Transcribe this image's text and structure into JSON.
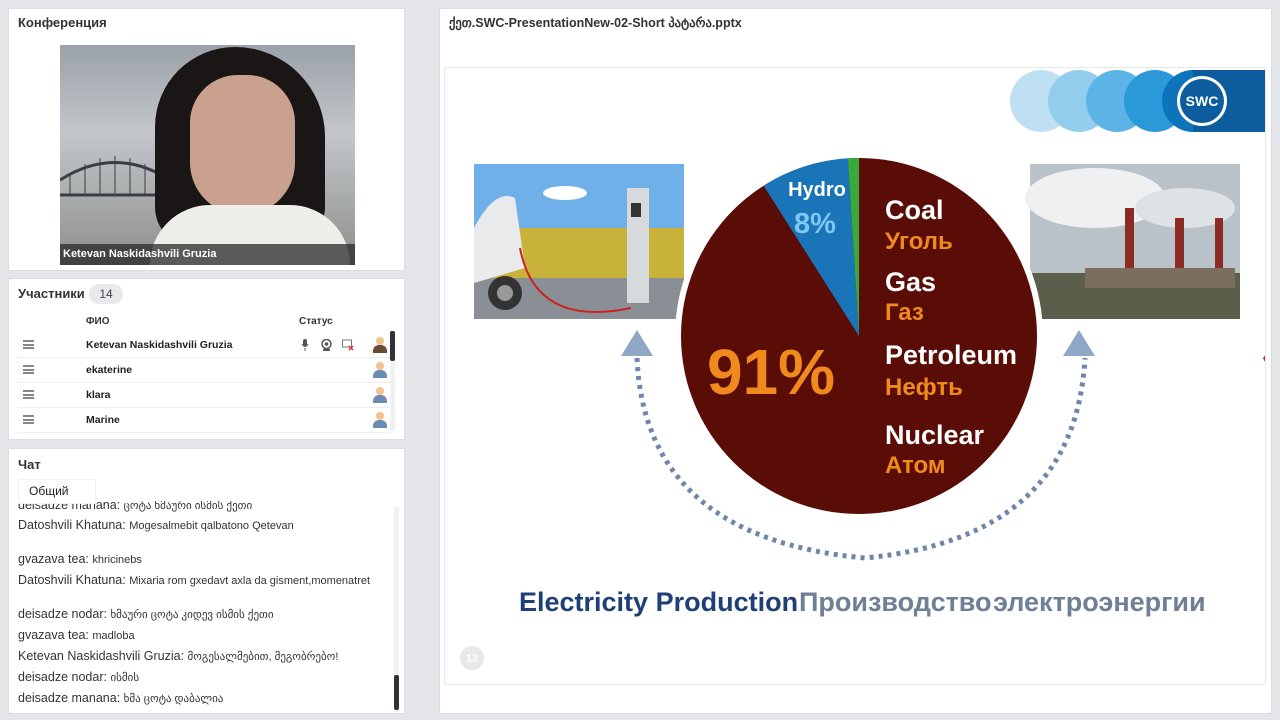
{
  "conference": {
    "title": "Конференция",
    "video_caption": "Ketevan Naskidashvili Gruzia"
  },
  "participants": {
    "title": "Участники",
    "count": "14",
    "col_name": "ФИО",
    "col_status": "Статус",
    "rows": [
      {
        "name": "Ketevan Naskidashvili Gruzia"
      },
      {
        "name": "ekaterine"
      },
      {
        "name": "klara"
      },
      {
        "name": "Marine"
      }
    ]
  },
  "chat": {
    "title": "Чат",
    "tab": "Общий",
    "messages": [
      {
        "author": "deisadze  manana:",
        "text": "ცოტა ხმაური ისმის ქეთი"
      },
      {
        "author": "Datoshvili  Khatuna:",
        "text": "Mogesalmebit qalbatono Qetevan"
      },
      {
        "author": "gvazava tea:",
        "text": "khricinebs"
      },
      {
        "author": "Datoshvili  Khatuna:",
        "text": "Mixaria rom gxedavt axla  da gisment,momenatret"
      },
      {
        "author": "deisadze nodar:",
        "text": "ხმაური ცოტა კიდევ ისმის ქეთი"
      },
      {
        "author": "gvazava tea:",
        "text": "madloba"
      },
      {
        "author": "Ketevan Naskidashvili Gruzia:",
        "text": "მოგესალმებით, მეგობრებო!"
      },
      {
        "author": "deisadze  nodar:",
        "text": " ისმის"
      },
      {
        "author": "deisadze manana:",
        "text": "ხმა ცოტა დაბალია"
      }
    ]
  },
  "presentation": {
    "title": "ქეთ.SWC-PresentationNew-02-Short პატარა.pptx",
    "slide": {
      "logo": "SWC",
      "hydro_label": "Hydro",
      "hydro_pct": "8%",
      "main_pct": "91%",
      "sources": [
        {
          "en": "Coal",
          "ru": "Уголь"
        },
        {
          "en": "Gas",
          "ru": "Газ"
        },
        {
          "en": "Petroleum",
          "ru": "Нефть"
        },
        {
          "en": "Nuclear",
          "ru": "Атом"
        }
      ],
      "caption_en": "Electricity Production",
      "caption_ru1": "Производство",
      "caption_ru2": "электроэнергии",
      "page_number": "12",
      "colors": {
        "main": "#5a0c07",
        "hydro": "#1a74b8",
        "green": "#3aa83a",
        "orange": "#f08a1c",
        "navy": "#1f3f77",
        "grey": "#6e7f96"
      }
    }
  }
}
